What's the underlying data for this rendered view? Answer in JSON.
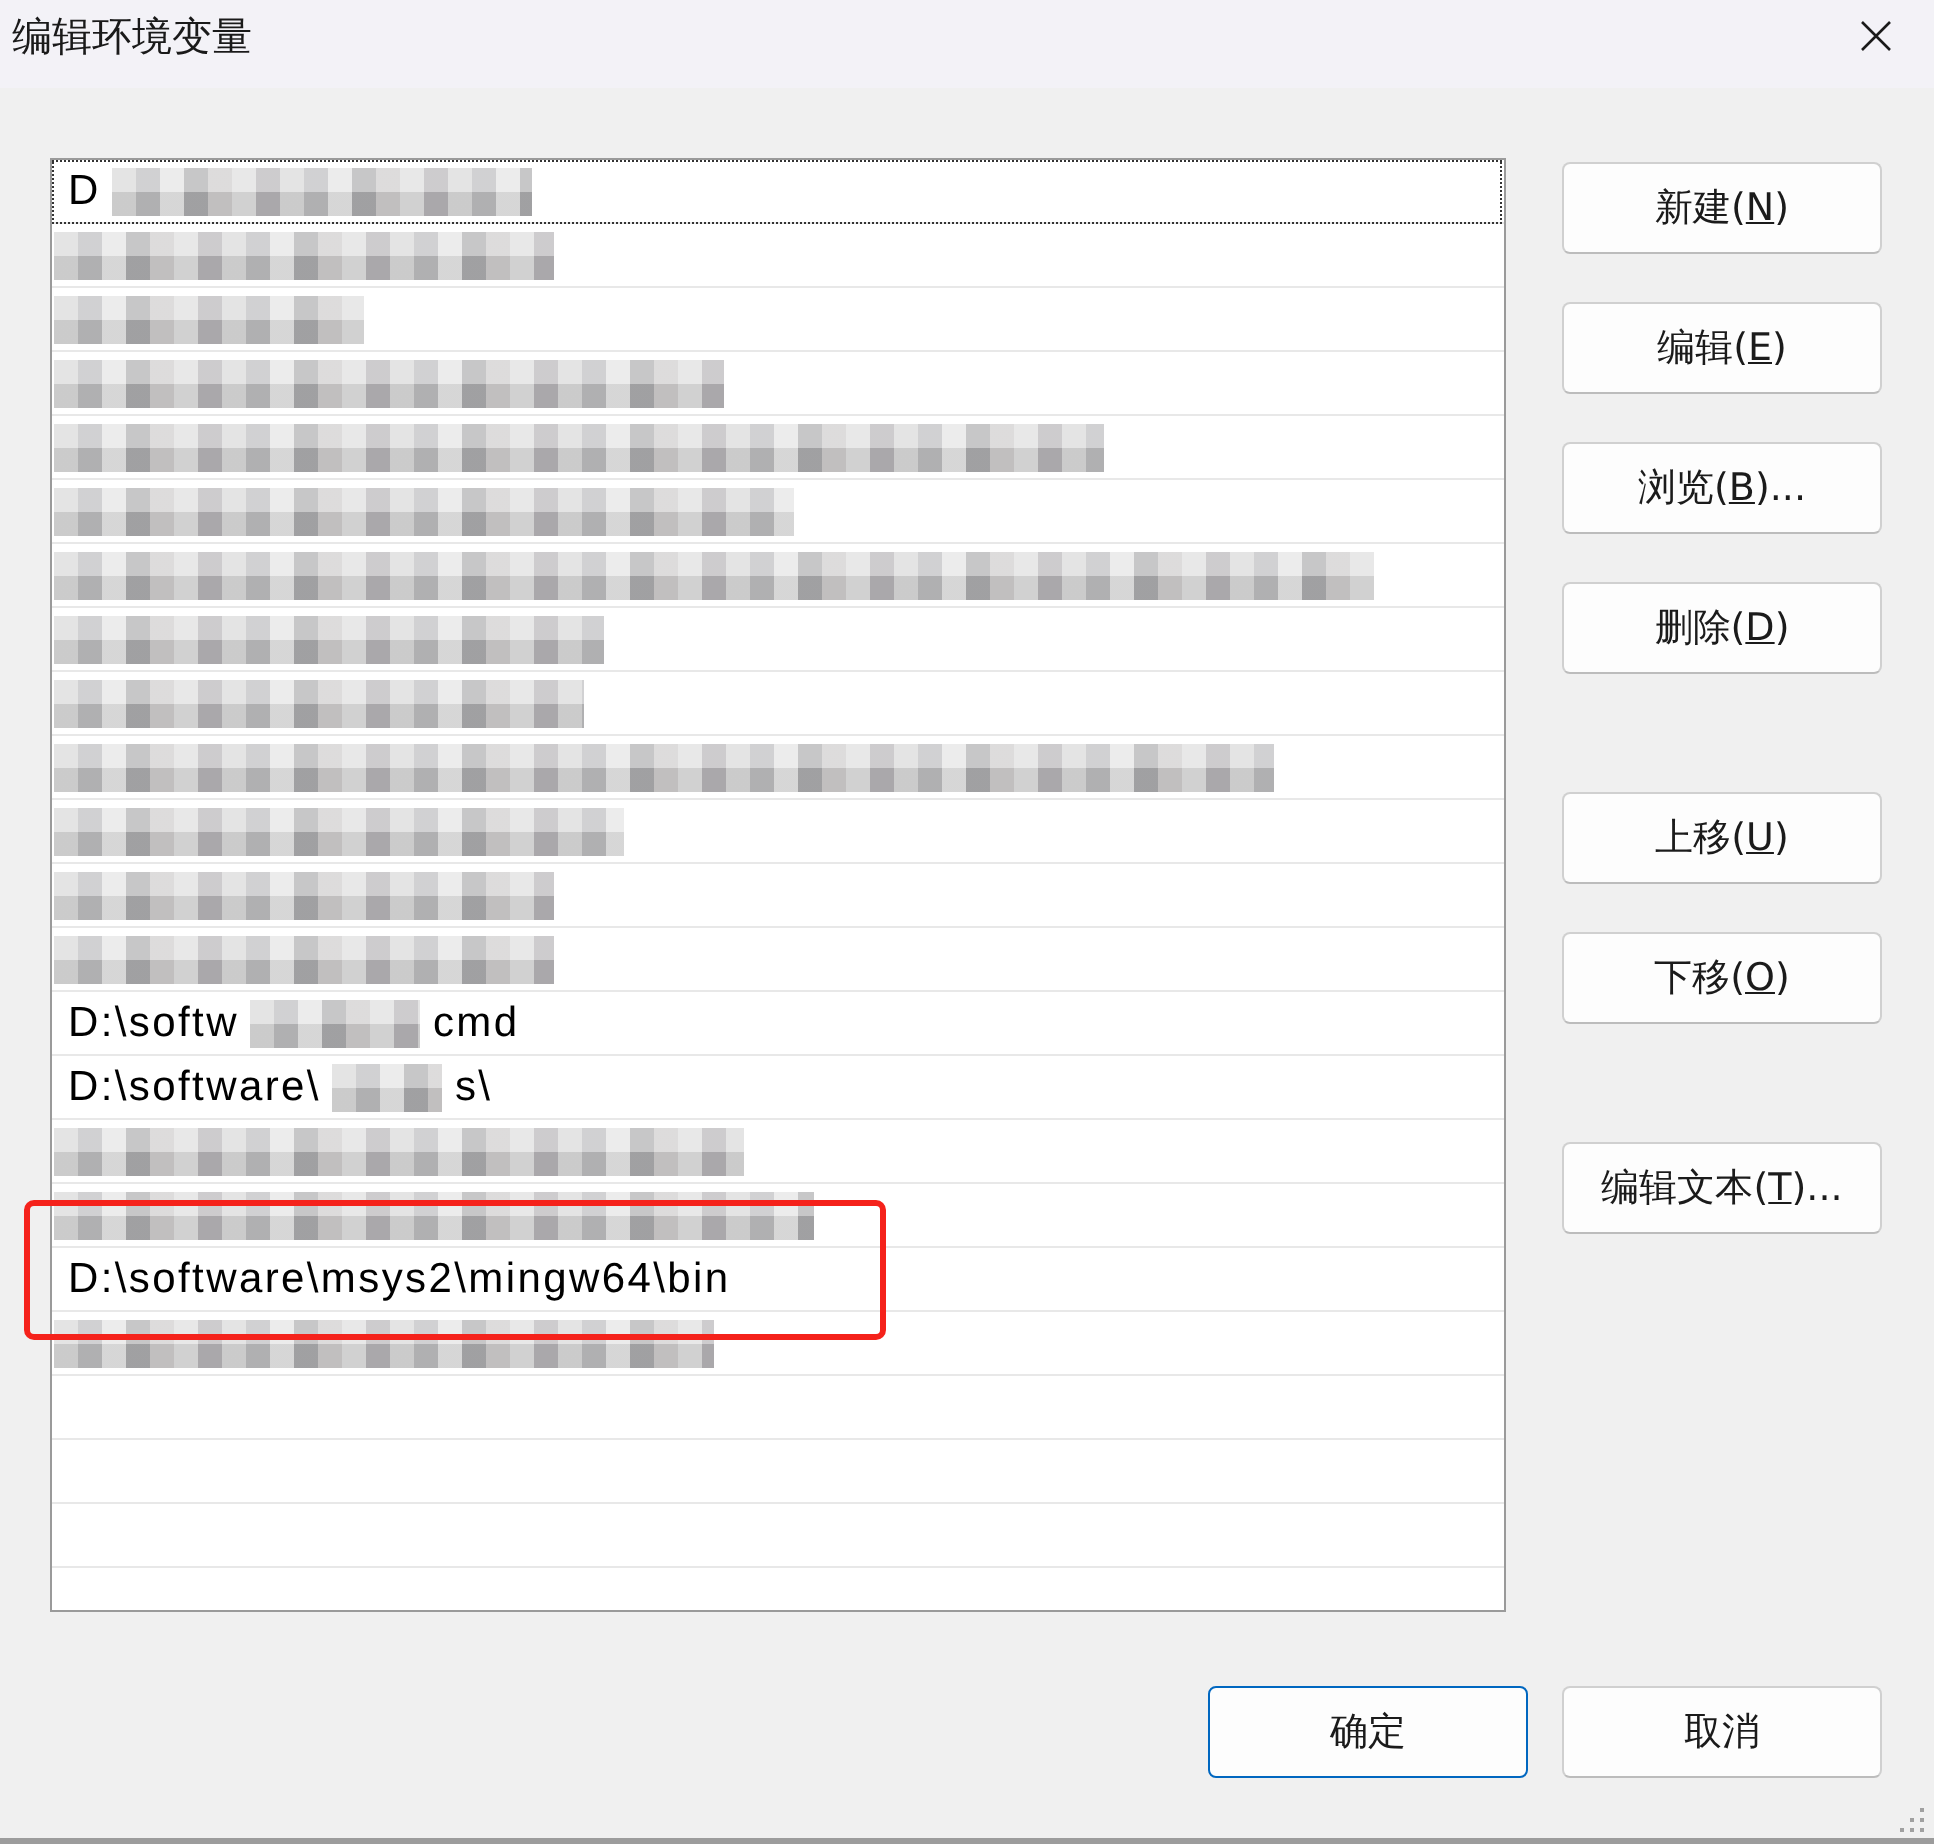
{
  "window": {
    "title": "编辑环境变量"
  },
  "rows": [
    {
      "text": "D",
      "redacted": true,
      "focused": true,
      "highlighted": false
    },
    {
      "redacted": true,
      "focused": false,
      "highlighted": false
    },
    {
      "redacted": true,
      "focused": false,
      "highlighted": false
    },
    {
      "redacted": true,
      "focused": false,
      "highlighted": false
    },
    {
      "redacted": true,
      "focused": false,
      "highlighted": false
    },
    {
      "redacted": true,
      "focused": false,
      "highlighted": false
    },
    {
      "redacted": true,
      "focused": false,
      "highlighted": false
    },
    {
      "redacted": true,
      "focused": false,
      "highlighted": false
    },
    {
      "redacted": true,
      "focused": false,
      "highlighted": false
    },
    {
      "redacted": true,
      "focused": false,
      "highlighted": false
    },
    {
      "redacted": true,
      "focused": false,
      "highlighted": false
    },
    {
      "redacted": true,
      "focused": false,
      "highlighted": false
    },
    {
      "redacted": true,
      "focused": false,
      "highlighted": false
    },
    {
      "text": "D:\\softw",
      "tail": "cmd",
      "redacted": true,
      "focused": false,
      "highlighted": false
    },
    {
      "text": "D:\\software\\",
      "tail": "s\\",
      "redacted": true,
      "focused": false,
      "highlighted": false
    },
    {
      "redacted": true,
      "focused": false,
      "highlighted": false
    },
    {
      "redacted": true,
      "focused": false,
      "highlighted": true
    },
    {
      "text": "D:\\software\\msys2\\mingw64\\bin",
      "redacted": false,
      "focused": false,
      "highlighted": true
    },
    {
      "redacted": true,
      "focused": false,
      "highlighted": false
    }
  ],
  "button_groups": [
    [
      {
        "before": "新建(",
        "key": "N",
        "after": ")"
      },
      {
        "before": "编辑(",
        "key": "E",
        "after": ")"
      },
      {
        "before": "浏览(",
        "key": "B",
        "after": ")..."
      },
      {
        "before": "删除(",
        "key": "D",
        "after": ")"
      }
    ],
    [
      {
        "before": "上移(",
        "key": "U",
        "after": ")"
      },
      {
        "before": "下移(",
        "key": "O",
        "after": ")"
      }
    ],
    [
      {
        "before": "编辑文本(",
        "key": "T",
        "after": ")..."
      }
    ]
  ],
  "dialog_buttons": [
    {
      "label": "确定",
      "default": true
    },
    {
      "label": "取消",
      "default": false
    }
  ]
}
